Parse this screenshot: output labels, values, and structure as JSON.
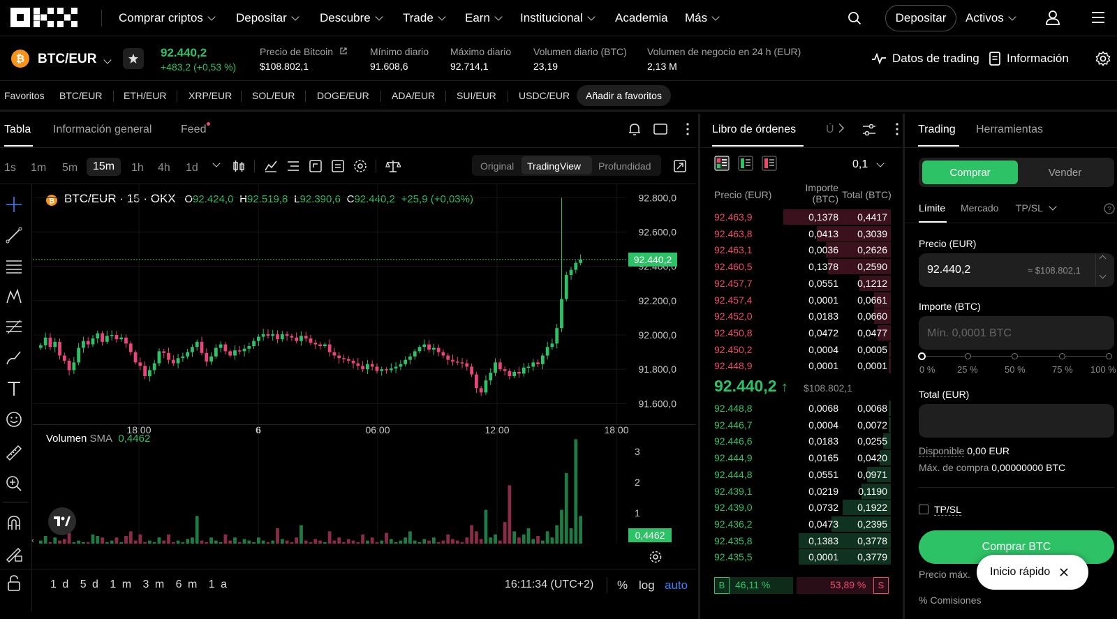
{
  "nav": {
    "items": [
      {
        "label": "Comprar criptos",
        "dropdown": true
      },
      {
        "label": "Depositar",
        "dropdown": true
      },
      {
        "label": "Descubre",
        "dropdown": true
      },
      {
        "label": "Trade",
        "dropdown": true
      },
      {
        "label": "Earn",
        "dropdown": true
      },
      {
        "label": "Institucional",
        "dropdown": true
      },
      {
        "label": "Academia",
        "dropdown": false
      },
      {
        "label": "Más",
        "dropdown": true
      }
    ],
    "deposit_button": "Depositar",
    "assets_label": "Activos",
    "icons": [
      "search-icon",
      "user-icon",
      "menu-icon"
    ]
  },
  "ticker": {
    "pair": "BTC/EUR",
    "last_price": "92.440,2",
    "change": "+483,2 (+0,53 %)",
    "stats": [
      {
        "label": "Precio de Bitcoin",
        "value": "$108.802,1"
      },
      {
        "label": "Mínimo diario",
        "value": "91.608,6"
      },
      {
        "label": "Máximo diario",
        "value": "92.714,1"
      },
      {
        "label": "Volumen diario (BTC)",
        "value": "23,19"
      },
      {
        "label": "Volumen de negocio en 24 h (EUR)",
        "value": "2,13 M"
      }
    ],
    "trading_data_label": "Datos de trading",
    "info_label": "Información"
  },
  "favorites": {
    "label": "Favoritos",
    "pairs": [
      "BTC/EUR",
      "ETH/EUR",
      "XRP/EUR",
      "SOL/EUR",
      "DOGE/EUR",
      "ADA/EUR",
      "SUI/EUR",
      "USDC/EUR"
    ],
    "add_label": "Añadir a favoritos"
  },
  "chart_panel": {
    "tabs": [
      "Tabla",
      "Información general",
      "Feed"
    ],
    "timeframes": [
      "1s",
      "1m",
      "5m",
      "15m",
      "1h",
      "4h",
      "1d"
    ],
    "active_timeframe": "15m",
    "view_modes": [
      "Original",
      "TradingView",
      "Profundidad"
    ],
    "active_view": "TradingView",
    "legend": {
      "title": "BTC/EUR · 15 · OKX",
      "o_label": "O",
      "o": "92.424,0",
      "h_label": "H",
      "h": "92.519,8",
      "l_label": "L",
      "l": "92.390,6",
      "c_label": "C",
      "c": "92.440,2",
      "chg": "+25,9 (+0,03%)"
    },
    "volume_legend": {
      "label": "Volumen",
      "sma_label": "SMA",
      "value": "0,4462"
    },
    "bottom": {
      "ranges": [
        "1 d",
        "5 d",
        "1 m",
        "3 m",
        "6 m",
        "1 a"
      ],
      "time": "16:11:34 (UTC+2)",
      "pct": "%",
      "log": "log",
      "auto": "auto"
    }
  },
  "chart_data": {
    "type": "candlestick",
    "title": "BTC/EUR · 15 · OKX",
    "y_axis_ticks": [
      "92.800,0",
      "92.600,0",
      "92.400,0",
      "92.200,0",
      "92.000,0",
      "91.800,0",
      "91.600,0"
    ],
    "x_axis_ticks": [
      "18:00",
      "6",
      "06:00",
      "12:00",
      "18:00"
    ],
    "ylim": [
      91520,
      92830
    ],
    "current_price_label": "92.440,2",
    "volume_axis_ticks": [
      "3",
      "2",
      "1"
    ],
    "volume_sma_label": "0,4462",
    "up_color": "#2ec267",
    "down_color": "#e8467a",
    "candles_close": [
      91940,
      91985,
      91930,
      91960,
      91880,
      91850,
      91795,
      91840,
      91925,
      91965,
      91945,
      91980,
      92010,
      91960,
      91995,
      92000,
      91975,
      91985,
      91950,
      91900,
      91840,
      91820,
      91760,
      91795,
      91835,
      91905,
      91895,
      91855,
      91835,
      91865,
      91875,
      91900,
      91930,
      91960,
      91895,
      91845,
      91875,
      91925,
      91945,
      91905,
      91880,
      91910,
      91905,
      91920,
      91935,
      91965,
      91990,
      92005,
      91995,
      92005,
      91975,
      92005,
      91995,
      91985,
      91965,
      91995,
      91980,
      91955,
      91945,
      91935,
      91945,
      91900,
      91880,
      91865,
      91860,
      91850,
      91835,
      91820,
      91800,
      91830,
      91815,
      91790,
      91800,
      91795,
      91805,
      91815,
      91830,
      91855,
      91875,
      91905,
      91930,
      91945,
      91915,
      91925,
      91900,
      91880,
      91855,
      91845,
      91840,
      91835,
      91815,
      91770,
      91690,
      91665,
      91735,
      91780,
      91840,
      91800,
      91790,
      91760,
      91785,
      91775,
      91810,
      91815,
      91840,
      91830,
      91880,
      91930,
      91950,
      92040,
      92210,
      92350,
      92380,
      92420,
      92440
    ],
    "volumes": [
      0.1,
      0.25,
      0.05,
      0.2,
      0.1,
      0.15,
      0.35,
      0.05,
      0.1,
      0.05,
      0.05,
      0.3,
      0.25,
      0.2,
      0.05,
      0.1,
      0.2,
      0.05,
      0.25,
      0.4,
      0.1,
      0.3,
      0.05,
      0.1,
      0.05,
      0.2,
      0.1,
      0.3,
      0.05,
      0.1,
      0.05,
      0.15,
      0.2,
      0.9,
      0.1,
      0.05,
      0.2,
      0.1,
      0.05,
      0.3,
      0.1,
      0.2,
      0.05,
      0.15,
      0.1,
      0.05,
      0.2,
      0.1,
      0.05,
      0.1,
      0.5,
      0.15,
      0.1,
      0.05,
      0.2,
      0.6,
      0.1,
      0.05,
      0.15,
      0.1,
      0.05,
      0.4,
      0.1,
      0.2,
      0.05,
      0.15,
      0.1,
      0.05,
      0.3,
      0.1,
      0.2,
      0.05,
      0.1,
      0.35,
      0.15,
      0.05,
      0.1,
      0.2,
      0.4,
      0.1,
      0.05,
      0.15,
      0.1,
      0.2,
      0.05,
      0.1,
      0.3,
      0.15,
      0.1,
      0.05,
      0.2,
      0.6,
      0.4,
      0.15,
      1.1,
      0.2,
      0.3,
      0.1,
      0.7,
      1.9,
      0.4,
      0.2,
      0.3,
      0.5,
      0.15,
      0.25,
      0.1,
      0.4,
      0.2,
      0.6,
      1.1,
      2.3,
      0.5,
      3.4,
      0.9
    ]
  },
  "orderbook": {
    "tabs": [
      "Libro de órdenes",
      "Ú"
    ],
    "precision": "0,1",
    "headers": {
      "price": "Precio (EUR)",
      "amount_1": "Importe",
      "amount_2": "(BTC)",
      "total": "Total (BTC)"
    },
    "asks": [
      {
        "price": "92.463,9",
        "amount": "0,1378",
        "total": "0,4417",
        "depth": 0.58
      },
      {
        "price": "92.463,8",
        "amount": "0,0413",
        "total": "0,3039",
        "depth": 0.4
      },
      {
        "price": "92.463,1",
        "amount": "0,0036",
        "total": "0,2626",
        "depth": 0.35
      },
      {
        "price": "92.460,5",
        "amount": "0,1378",
        "total": "0,2590",
        "depth": 0.34
      },
      {
        "price": "92.457,7",
        "amount": "0,0551",
        "total": "0,1212",
        "depth": 0.17
      },
      {
        "price": "92.457,4",
        "amount": "0,0001",
        "total": "0,0661",
        "depth": 0.09
      },
      {
        "price": "92.452,0",
        "amount": "0,0183",
        "total": "0,0660",
        "depth": 0.09
      },
      {
        "price": "92.450,8",
        "amount": "0,0472",
        "total": "0,0477",
        "depth": 0.07
      },
      {
        "price": "92.450,2",
        "amount": "0,0004",
        "total": "0,0005",
        "depth": 0.01
      },
      {
        "price": "92.448,9",
        "amount": "0,0001",
        "total": "0,0001",
        "depth": 0.01
      }
    ],
    "mid_price": "92.440,2",
    "mid_usd": "$108.802,1",
    "bids": [
      {
        "price": "92.448,8",
        "amount": "0,0068",
        "total": "0,0068",
        "depth": 0.01
      },
      {
        "price": "92.446,7",
        "amount": "0,0004",
        "total": "0,0072",
        "depth": 0.01
      },
      {
        "price": "92.446,6",
        "amount": "0,0183",
        "total": "0,0255",
        "depth": 0.04
      },
      {
        "price": "92.444,9",
        "amount": "0,0165",
        "total": "0,0420",
        "depth": 0.06
      },
      {
        "price": "92.444,8",
        "amount": "0,0551",
        "total": "0,0971",
        "depth": 0.13
      },
      {
        "price": "92.439,1",
        "amount": "0,0219",
        "total": "0,1190",
        "depth": 0.16
      },
      {
        "price": "92.439,0",
        "amount": "0,0732",
        "total": "0,1922",
        "depth": 0.26
      },
      {
        "price": "92.436,2",
        "amount": "0,0473",
        "total": "0,2395",
        "depth": 0.32
      },
      {
        "price": "92.435,8",
        "amount": "0,1383",
        "total": "0,3778",
        "depth": 0.5
      },
      {
        "price": "92.435,5",
        "amount": "0,0001",
        "total": "0,3779",
        "depth": 0.5
      }
    ],
    "buy_ratio": "46,11 %",
    "sell_ratio": "53,89 %",
    "buy_tag": "B",
    "sell_tag": "S"
  },
  "trade": {
    "tabs": [
      "Trading",
      "Herramientas"
    ],
    "buy_label": "Comprar",
    "sell_label": "Vender",
    "order_types": [
      "Límite",
      "Mercado",
      "TP/SL"
    ],
    "price_label": "Precio (EUR)",
    "price_value": "92.440,2",
    "price_usd": "≈ $108.802,1",
    "amount_label": "Importe (BTC)",
    "amount_placeholder": "Mín. 0,0001 BTC",
    "slider_marks": [
      "0 %",
      "25 %",
      "50 %",
      "75 %",
      "100 %"
    ],
    "total_label": "Total (EUR)",
    "available_label": "Disponible",
    "available_value": "0,00 EUR",
    "max_buy_label": "Máx. de compra",
    "max_buy_value": "0,00000000 BTC",
    "tpsl_label": "TP/SL",
    "buy_button": "Comprar BTC",
    "price_max_label": "Precio máx.",
    "fees_label": "% Comisiones",
    "quick_start": "Inicio rápido"
  }
}
